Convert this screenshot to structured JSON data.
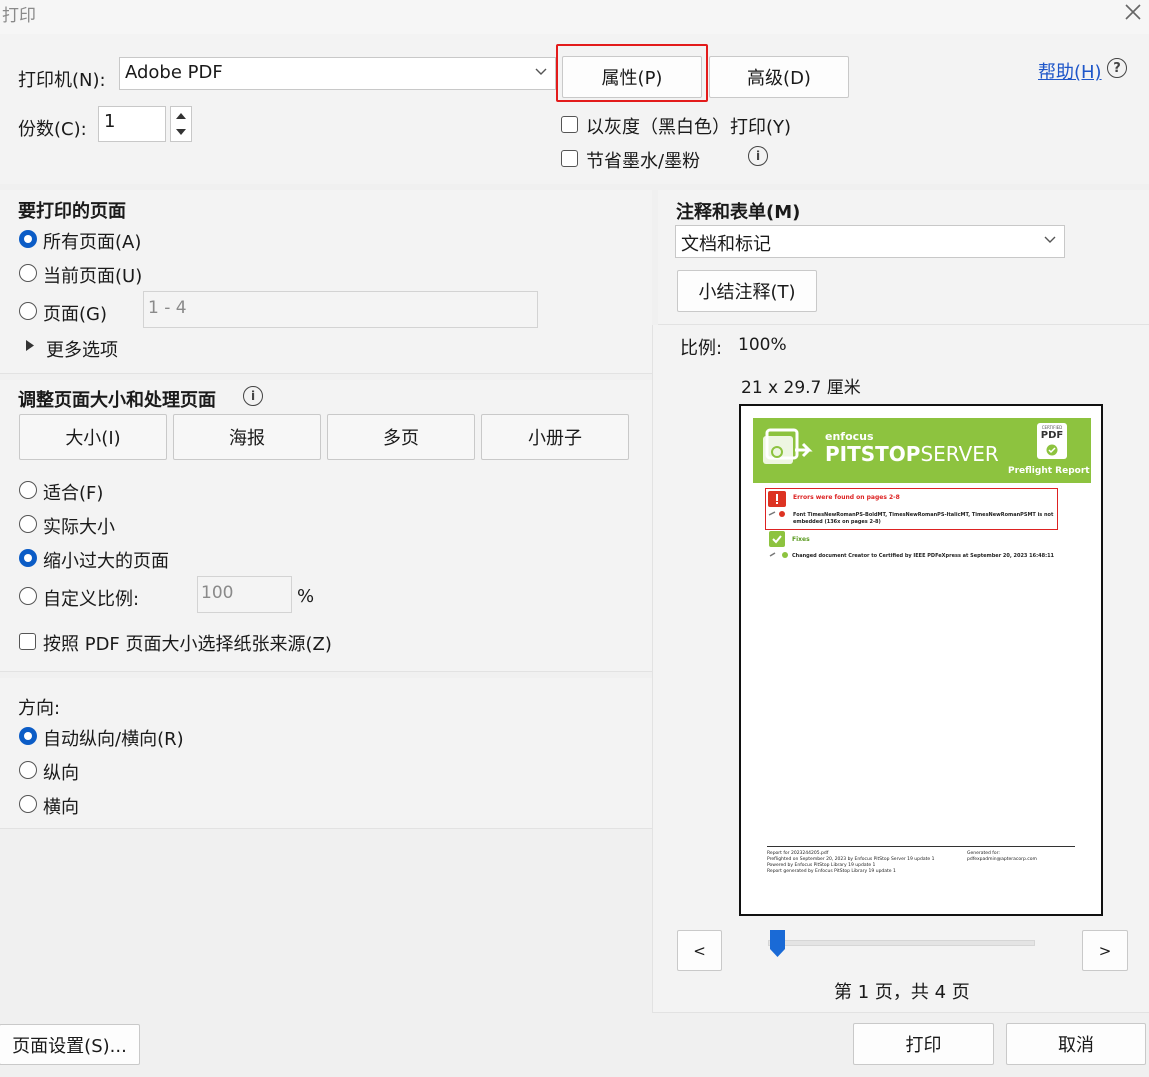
{
  "window": {
    "title": "打印"
  },
  "printer": {
    "label": "打印机(N):",
    "value": "Adobe PDF"
  },
  "copies": {
    "label": "份数(C):",
    "value": "1"
  },
  "buttons": {
    "properties": "属性(P)",
    "advanced": "高级(D)",
    "help": "帮助(H)",
    "page_setup": "页面设置(S)...",
    "print": "打印",
    "cancel": "取消",
    "summarize": "小结注释(T)"
  },
  "options": {
    "grayscale": "以灰度（黑白色）打印(Y)",
    "save_ink": "节省墨水/墨粉"
  },
  "pages_section": {
    "heading": "要打印的页面",
    "all": "所有页面(A)",
    "current": "当前页面(U)",
    "pages": "页面(G)",
    "pages_placeholder": "1 - 4",
    "more": "更多选项"
  },
  "sizing_section": {
    "heading": "调整页面大小和处理页面",
    "tabs": [
      "大小(I)",
      "海报",
      "多页",
      "小册子"
    ],
    "fit": "适合(F)",
    "actual": "实际大小",
    "shrink": "缩小过大的页面",
    "custom": "自定义比例:",
    "custom_value": "100",
    "percent": "%",
    "paper_source": "按照 PDF 页面大小选择纸张来源(Z)"
  },
  "orientation": {
    "heading": "方向:",
    "auto": "自动纵向/横向(R)",
    "portrait": "纵向",
    "landscape": "横向"
  },
  "comments": {
    "heading": "注释和表单(M)",
    "value": "文档和标记"
  },
  "preview": {
    "scale_label": "比例:",
    "scale_value": "100%",
    "paper_size": "21 x 29.7 厘米",
    "page_info": "第 1 页，共 4 页",
    "prev": "<",
    "next": ">",
    "page_progress": 0.0
  },
  "report": {
    "brand_top": "enfocus",
    "brand_bold": "PITSTOP",
    "brand_light": "SERVER",
    "badge_top": "CERTIFIED",
    "badge_pdf": "PDF",
    "preflight": "Preflight Report",
    "error_title": "Errors were found on pages 2-8",
    "error_text_1": "Font TimesNewRomanPS-BoldMT, TimesNewRomanPS-ItalicMT, TimesNewRomanPSMT is not",
    "error_text_2": "embedded (136x on pages 2-8)",
    "fixes_title": "Fixes",
    "fix_text": "Changed document Creator to Certified by IEEE PDFeXpress at September 20, 2023 16:48:11",
    "footer_left": [
      "Report for 2023244205.pdf",
      "Preflighted on September 20, 2023 by Enfocus PitStop Server 19 update 1",
      "Powered by Enfocus PitStop Library 19 update 1",
      "Report generated by Enfocus PitStop Library 19 update 1"
    ],
    "footer_right": [
      "Generated for:",
      "pdfexpadmin@apteracorp.com"
    ]
  },
  "colors": {
    "accent": "#0b5cc6",
    "highlight": "#e31b1b",
    "report_green": "#8dc33f"
  }
}
